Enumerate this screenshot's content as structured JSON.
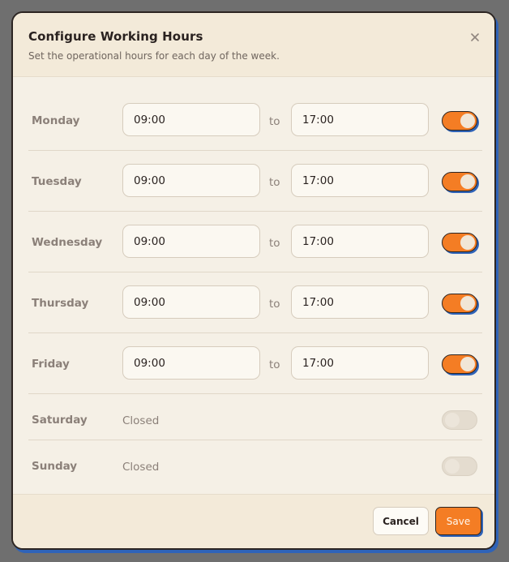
{
  "dialog": {
    "title": "Configure Working Hours",
    "subtitle": "Set the operational hours for each day of the week.",
    "close_icon": "close-icon"
  },
  "days": [
    {
      "label": "Monday",
      "open": true,
      "start": "09:00",
      "end": "17:00",
      "to": "to"
    },
    {
      "label": "Tuesday",
      "open": true,
      "start": "09:00",
      "end": "17:00",
      "to": "to"
    },
    {
      "label": "Wednesday",
      "open": true,
      "start": "09:00",
      "end": "17:00",
      "to": "to"
    },
    {
      "label": "Thursday",
      "open": true,
      "start": "09:00",
      "end": "17:00",
      "to": "to"
    },
    {
      "label": "Friday",
      "open": true,
      "start": "09:00",
      "end": "17:00",
      "to": "to"
    },
    {
      "label": "Saturday",
      "open": false,
      "status": "Closed"
    },
    {
      "label": "Sunday",
      "open": false,
      "status": "Closed"
    }
  ],
  "footer": {
    "cancel_label": "Cancel",
    "save_label": "Save"
  },
  "colors": {
    "accent": "#f47d24",
    "shadow": "#2f63b8",
    "panel": "#f5f0e6"
  }
}
